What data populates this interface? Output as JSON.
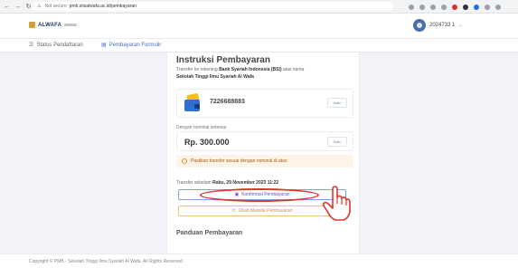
{
  "browser": {
    "back_icon": "arrow-left-icon",
    "forward_icon": "arrow-right-icon",
    "reload_icon": "reload-icon",
    "url_prefix": "Not secure",
    "url": "pmb.stisalwafa.ac.id/pembayaran"
  },
  "header": {
    "logo_text": "ALWAFA",
    "user_id": "2024733 1",
    "user_caret": "⌄"
  },
  "menu": {
    "items": [
      {
        "icon": "list-icon",
        "label": "Status Pendaftaran"
      },
      {
        "icon": "card-icon",
        "label": "Pembayaran Formulir"
      }
    ]
  },
  "payment": {
    "title": "Instruksi Pembayaran",
    "desc_prefix": "Transfer ke rekening ",
    "bank_name": "Bank Syariah Indonesia (BSI)",
    "desc_middle": " atas nama",
    "recipient": "Sekolah Tinggi Ilmu Syariah Al Wafa",
    "account_number": "7226688883",
    "copy_label": "Salin",
    "nominal_label": "Dengan nominal sebesar",
    "amount": "Rp. 300.000",
    "copy_label_2": "Salin",
    "warning": "Pastikan transfer sesuai dengan nominal di atas",
    "deadline_prefix": "Transfer sebelum ",
    "deadline": "Rabu, 29 November 2023 11:22",
    "confirm_label": "Konfirmasi Pembayaran",
    "change_method_label": "Ubah Metode Pembayaran",
    "guide_title": "Panduan Pembayaran"
  },
  "footer": {
    "text": "Copyright © PMB - Sekolah Tinggi Ilmu Syariah Al Wafa. All Rights Reserved"
  },
  "colors": {
    "primary": "#3a67c9",
    "warning": "#e08c1e",
    "annotation": "#e0362b"
  }
}
